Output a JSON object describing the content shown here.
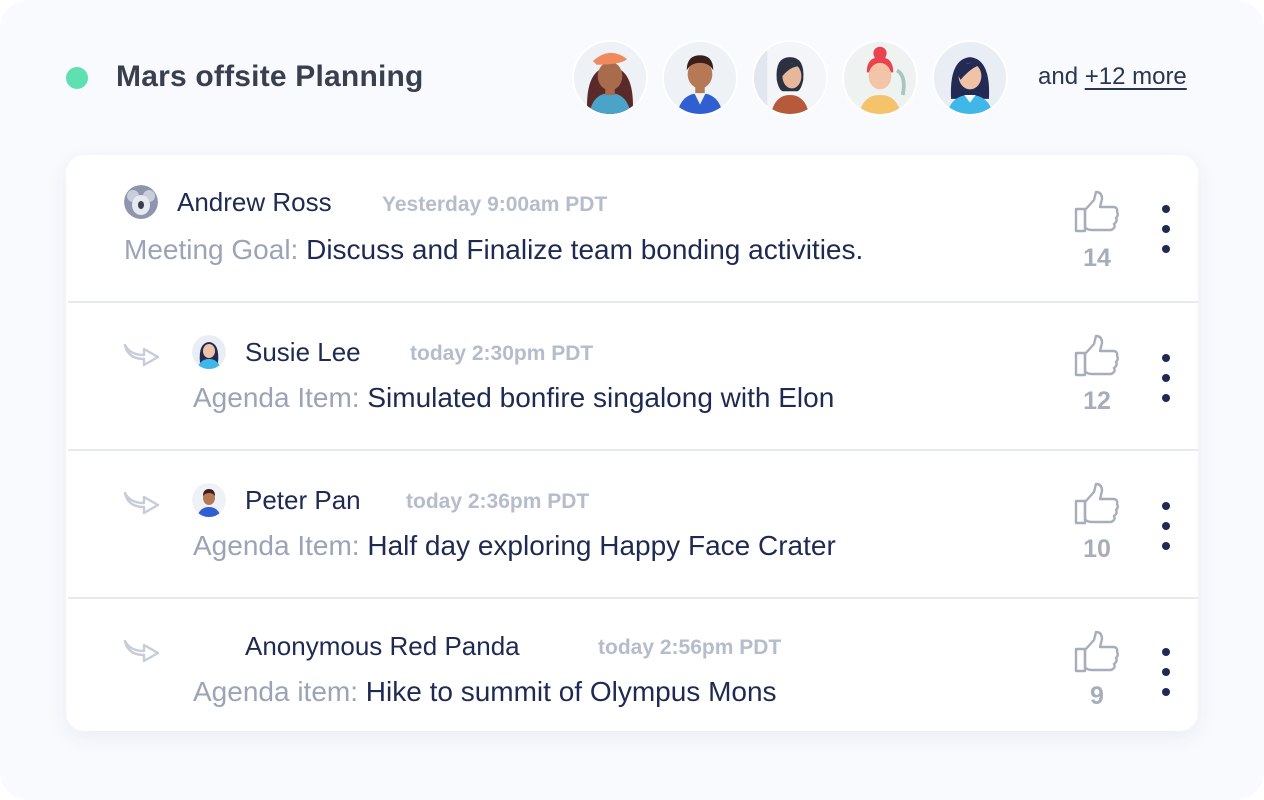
{
  "header": {
    "title": "Mars offsite Planning",
    "status_color": "#5fe0b0",
    "participants": [
      {
        "avatar": "woman-beret-avatar"
      },
      {
        "avatar": "man-avatar"
      },
      {
        "avatar": "woman-dark-hair-avatar"
      },
      {
        "avatar": "woman-red-hair-avatar"
      },
      {
        "avatar": "woman-blue-avatar"
      }
    ],
    "more_prefix": "and",
    "more_link": "+12 more"
  },
  "posts": [
    {
      "author": "Andrew Ross",
      "time": "Yesterday 9:00am PDT",
      "label": "Meeting Goal:",
      "text": "Discuss and Finalize team bonding activities.",
      "likes": "14",
      "avatar": "koala-avatar",
      "is_reply": false
    },
    {
      "author": "Susie Lee",
      "time": "today 2:30pm PDT",
      "label": "Agenda Item:",
      "text": "Simulated bonfire singalong with Elon",
      "likes": "12",
      "avatar": "woman-avatar",
      "is_reply": true
    },
    {
      "author": "Peter Pan",
      "time": "today 2:36pm PDT",
      "label": "Agenda Item:",
      "text": "Half day exploring Happy Face Crater",
      "likes": "10",
      "avatar": "man-avatar",
      "is_reply": true
    },
    {
      "author": "Anonymous Red Panda",
      "time": "today 2:56pm PDT",
      "label": "Agenda item:",
      "text": "Hike to summit of Olympus Mons",
      "likes": "9",
      "avatar": "",
      "is_reply": true
    }
  ],
  "colors": {
    "accent_text": "#1e2a52",
    "muted_label": "#9ba4b6",
    "timestamp": "#b5bccb",
    "like_icon": "#a7adbb"
  }
}
